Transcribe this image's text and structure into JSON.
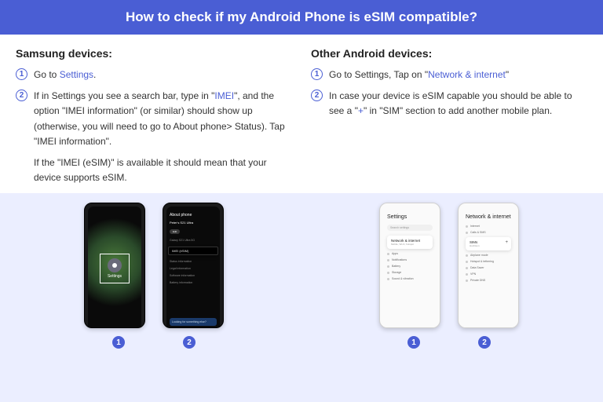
{
  "header": {
    "title": "How to check if my Android Phone is eSIM compatible?"
  },
  "samsung": {
    "title": "Samsung devices:",
    "steps": [
      {
        "num": "1",
        "prefix": "Go to ",
        "link": "Settings",
        "suffix": "."
      },
      {
        "num": "2",
        "prefix": "If in Settings you see a search bar, type in \"",
        "link": "IMEI",
        "suffix": "\", and the option \"IMEI information\" (or similar) should show up (otherwise, you will need to go to About phone> Status). Tap \"IMEI information\"."
      }
    ],
    "extra": "If the \"IMEI (eSIM)\" is available it should mean that your device supports eSIM.",
    "phone_labels": {
      "tile": "Settings",
      "about_header": "About phone",
      "about_sub": "Peter's S21 Ultra",
      "imei": "IMEI (eSIM)",
      "looking": "Looking for something else?"
    },
    "numbers": [
      "1",
      "2"
    ]
  },
  "other": {
    "title": "Other Android devices:",
    "steps": [
      {
        "num": "1",
        "prefix": "Go to Settings, Tap on \"",
        "link": "Network & internet",
        "suffix": "\""
      },
      {
        "num": "2",
        "prefix": "In case your device is eSIM capable you should be able to see a \"",
        "link": "+",
        "suffix": "\" in \"SIM\" section to add another mobile plan."
      }
    ],
    "phone_labels": {
      "settings": "Settings",
      "search": "Search settings",
      "net_card_main": "Network & internet",
      "net_card_sub": "Mobile, Wi-Fi, hotspot",
      "net_title": "Network & internet",
      "sim_main": "SIMs",
      "sim_sub": "Huchison"
    },
    "numbers": [
      "1",
      "2"
    ]
  }
}
